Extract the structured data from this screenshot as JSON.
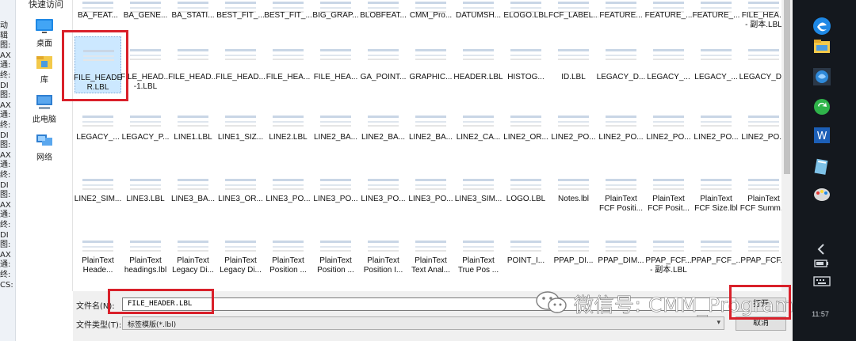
{
  "nav": {
    "quick_access": "快速访问",
    "items": [
      {
        "label": "桌面",
        "icon": "desktop-icon"
      },
      {
        "label": "库",
        "icon": "library-icon"
      },
      {
        "label": "此电脑",
        "icon": "this-pc-icon"
      },
      {
        "label": "网络",
        "icon": "network-icon"
      }
    ]
  },
  "left_fragments": [
    "动",
    "辑",
    "图:",
    "AX",
    "通:",
    "终:",
    "DI",
    "图:",
    "AX",
    "通:",
    "终:",
    "DI",
    "图:",
    "AX",
    "通:",
    "终:",
    "DI",
    "图:",
    "AX",
    "通:",
    "终:",
    "DI",
    "图:",
    "AX",
    "通:",
    "终:",
    "CS:"
  ],
  "files": [
    [
      "BA_FEAT...",
      "BA_GENE...",
      "BA_STATI...",
      "BEST_FIT_...",
      "BEST_FIT_...",
      "BIG_GRAP...",
      "BLOBFEAT...",
      "CMM_Pro...",
      "DATUMSH...",
      "ELOGO.LBL",
      "FCF_LABEL...",
      "FEATURE...",
      "FEATURE_...",
      "FEATURE_...",
      "FILE_HEA...\n- 副本.LBL"
    ],
    [
      "FILE_HEADE\nR.LBL",
      "FILE_HEAD...\n-1.LBL",
      "FILE_HEAD...",
      "FILE_HEAD...",
      "FILE_HEA...",
      "FILE_HEA...",
      "GA_POINT...",
      "GRAPHIC...",
      "HEADER.LBL",
      "HISTOG...",
      "ID.LBL",
      "LEGACY_D...",
      "LEGACY_...",
      "LEGACY_...",
      "LEGACY_D..."
    ],
    [
      "LEGACY_...",
      "LEGACY_P...",
      "LINE1.LBL",
      "LINE1_SIZ...",
      "LINE2.LBL",
      "LINE2_BA...",
      "LINE2_BA...",
      "LINE2_BA...",
      "LINE2_CA...",
      "LINE2_OR...",
      "LINE2_PO...",
      "LINE2_PO...",
      "LINE2_PO...",
      "LINE2_PO...",
      "LINE2_PO..."
    ],
    [
      "LINE2_SIM...",
      "LINE3.LBL",
      "LINE3_BA...",
      "LINE3_OR...",
      "LINE3_PO...",
      "LINE3_PO...",
      "LINE3_PO...",
      "LINE3_PO...",
      "LINE3_SIM...",
      "LOGO.LBL",
      "Notes.lbl",
      "PlainText\nFCF Positi...",
      "PlainText\nFCF Posit...",
      "PlainText\nFCF Size.lbl",
      "PlainText\nFCF Summ..."
    ],
    [
      "PlainText\nHeade...",
      "PlainText\nheadings.lbl",
      "PlainText\nLegacy Di...",
      "PlainText\nLegacy Di...",
      "PlainText\nPosition ...",
      "PlainText\nPosition ...",
      "PlainText\nPosition I...",
      "PlainText\nText Anal...",
      "PlainText\nTrue Pos ...",
      "POINT_I...",
      "PPAP_DI...",
      "PPAP_DIM...",
      "PPAP_FCF...\n- 副本.LBL",
      "PPAP_FCF_...",
      "PPAP_FCF..."
    ]
  ],
  "selected_file": "FILE_HEADE\nR.LBL",
  "filename_label": "文件名(N):",
  "filename_value": "FILE_HEADER.LBL",
  "filetype_label": "文件类型(T):",
  "filetype_value": "标签模版(*.lbl)",
  "open_button": "打开",
  "cancel_button": "取消",
  "watermark": "微信号: CMM_Programing",
  "clock": "11:57",
  "colors": {
    "highlight": "#d9202a",
    "selection": "#cce8ff",
    "taskbar": "#14181e"
  }
}
